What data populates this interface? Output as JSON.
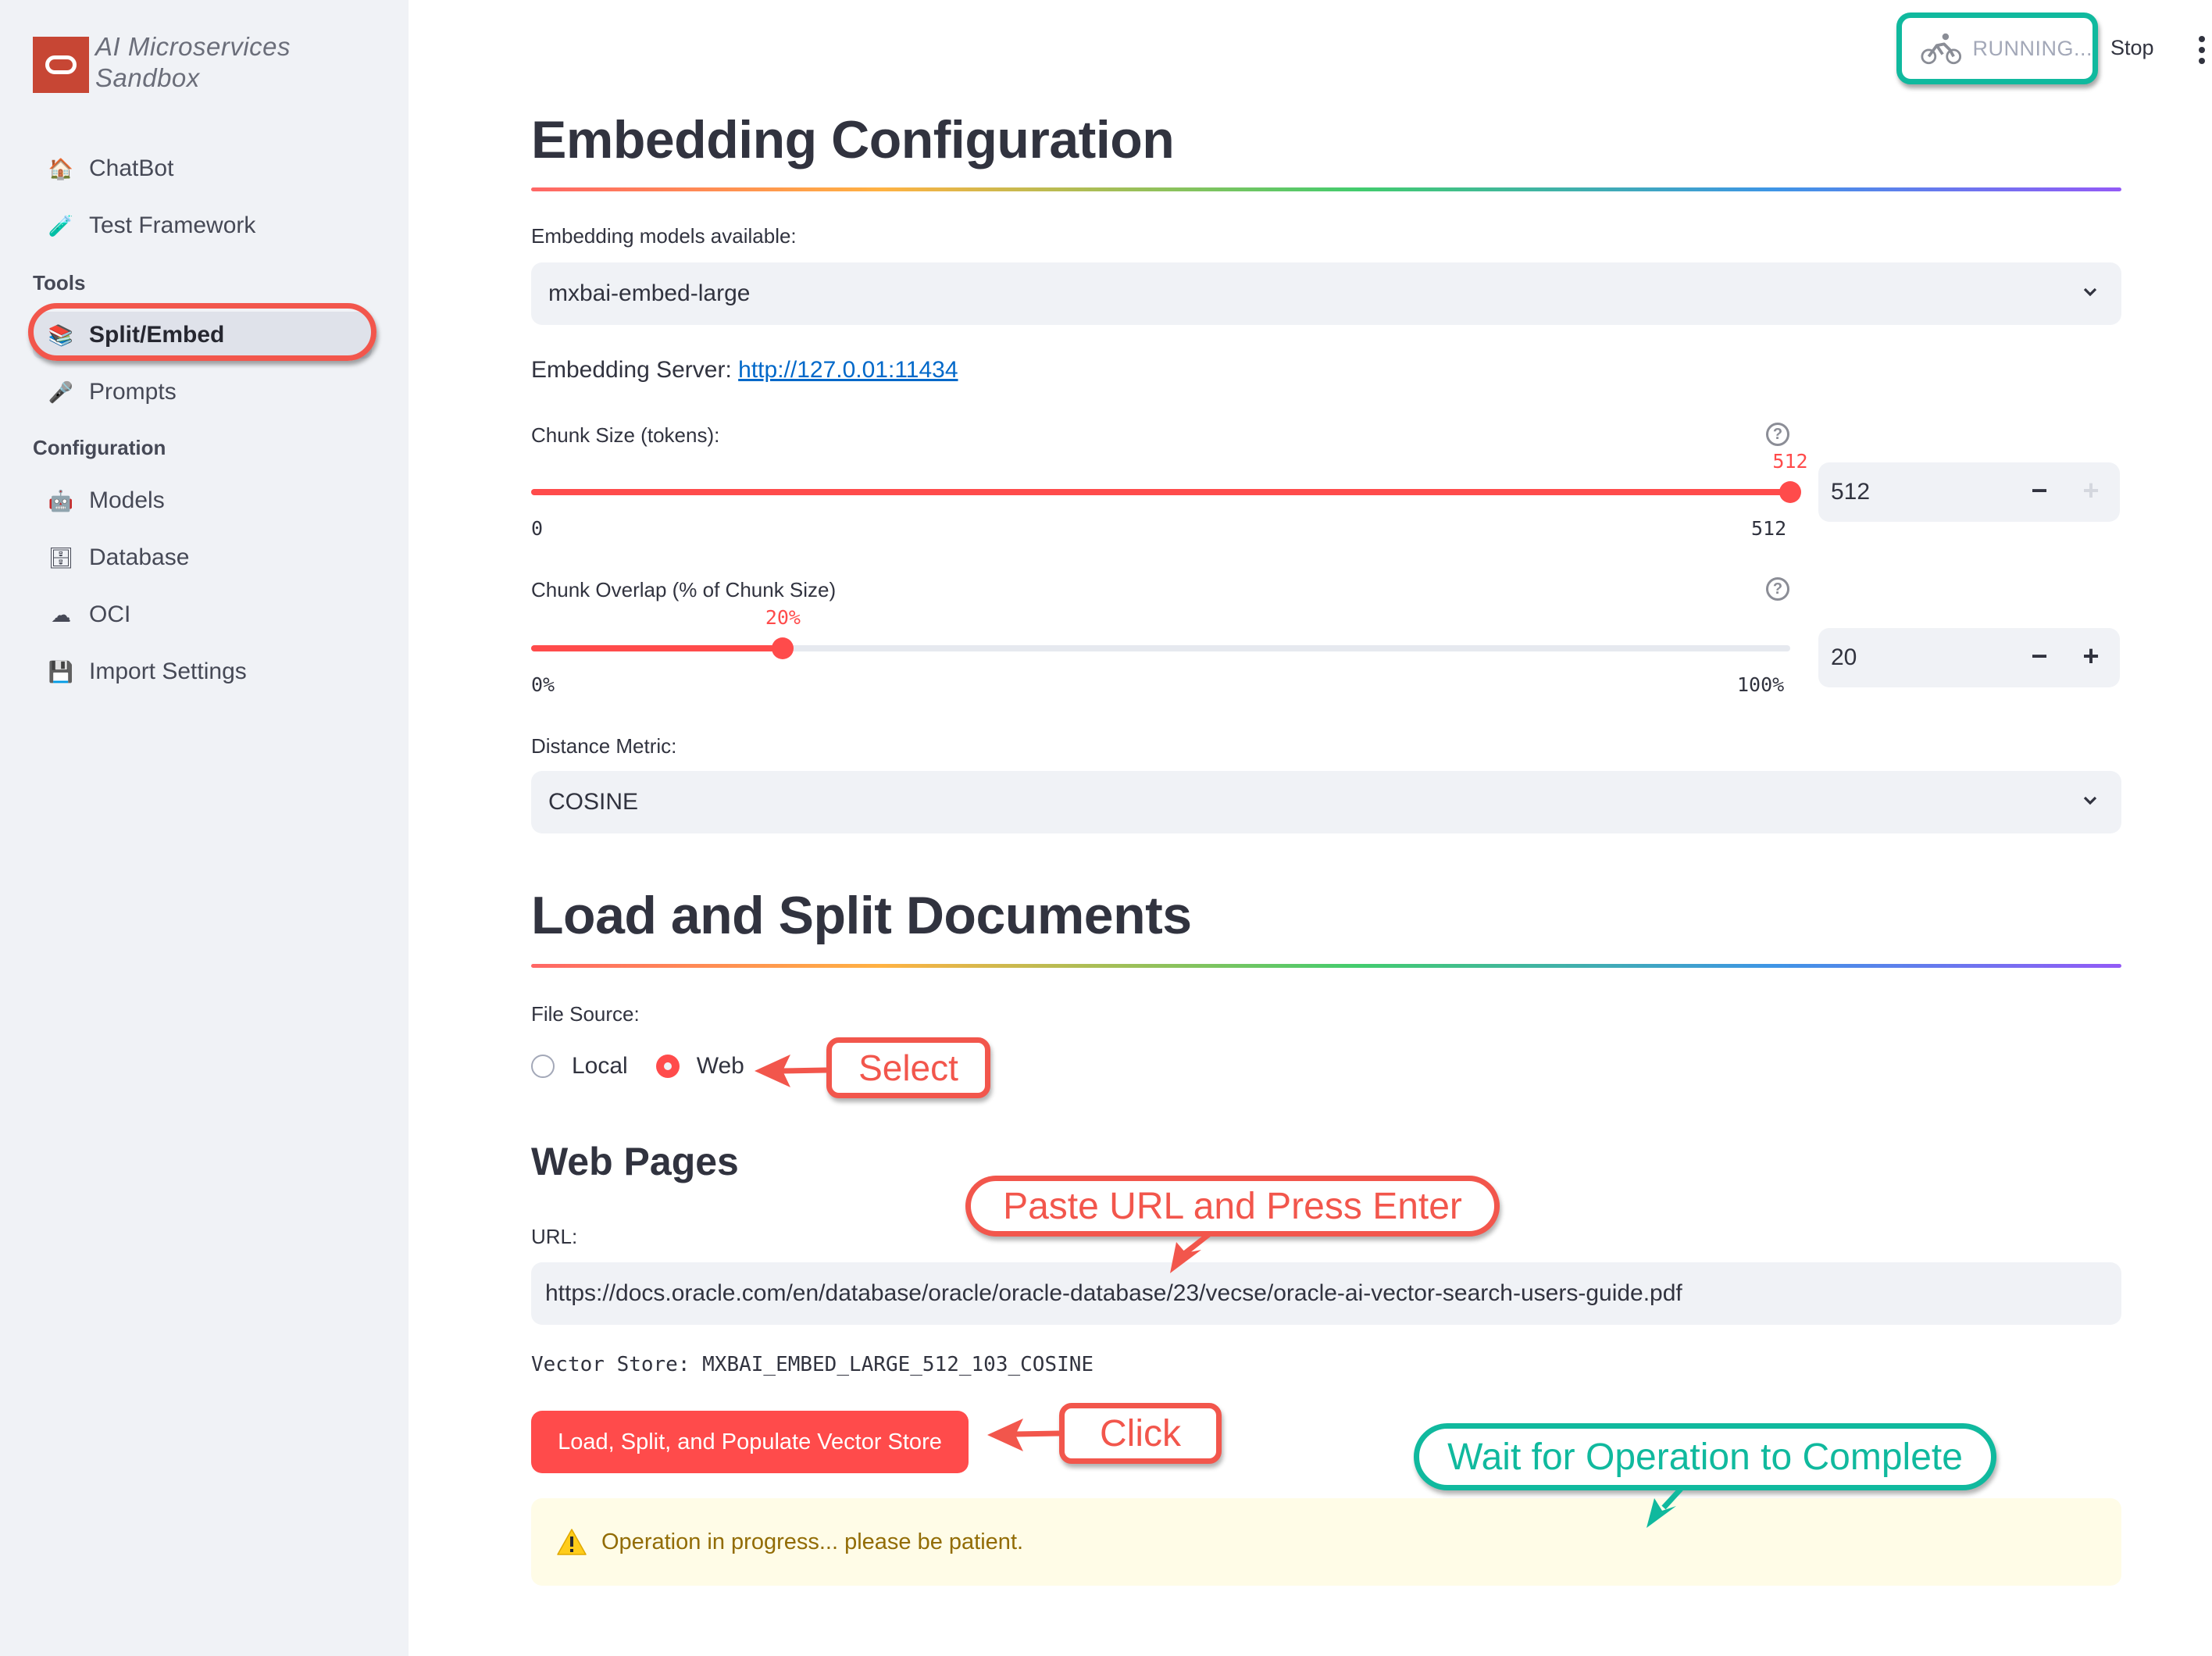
{
  "app": {
    "title": "AI Microservices Sandbox",
    "title_line1": "AI Microservices",
    "title_line2": "Sandbox"
  },
  "sidebar": {
    "items": [
      {
        "label": "ChatBot",
        "icon": "house-icon",
        "glyph": "🏠"
      },
      {
        "label": "Test Framework",
        "icon": "test-tube-icon",
        "glyph": "🧪"
      }
    ],
    "sections": [
      {
        "label": "Tools",
        "items": [
          {
            "label": "Split/Embed",
            "icon": "books-icon",
            "glyph": "📚",
            "active": true
          },
          {
            "label": "Prompts",
            "icon": "microphone-icon",
            "glyph": "🎤"
          }
        ]
      },
      {
        "label": "Configuration",
        "items": [
          {
            "label": "Models",
            "icon": "robot-icon",
            "glyph": "🤖"
          },
          {
            "label": "Database",
            "icon": "file-cabinet-icon",
            "glyph": "🗄"
          },
          {
            "label": "OCI",
            "icon": "cloud-icon",
            "glyph": "☁"
          },
          {
            "label": "Import Settings",
            "icon": "floppy-disk-icon",
            "glyph": "💾"
          }
        ]
      }
    ]
  },
  "toolbar": {
    "status": "RUNNING...",
    "stop_label": "Stop",
    "menu_icon": "kebab-menu-icon"
  },
  "embedding": {
    "heading": "Embedding Configuration",
    "models_label": "Embedding models available:",
    "model_selected": "mxbai-embed-large",
    "server_label": "Embedding Server:",
    "server_url": "http://127.0.01:11434",
    "chunk_size": {
      "label": "Chunk Size (tokens):",
      "value": 512,
      "value_label": "512",
      "min": 0,
      "max": 512,
      "min_label": "0",
      "max_label": "512",
      "input_value": "512",
      "plus_disabled": true
    },
    "chunk_overlap": {
      "label": "Chunk Overlap (% of Chunk Size)",
      "value": 20,
      "value_label": "20%",
      "min": 0,
      "max": 100,
      "min_label": "0%",
      "max_label": "100%",
      "input_value": "20",
      "plus_disabled": false
    },
    "distance_label": "Distance Metric:",
    "distance_selected": "COSINE"
  },
  "load": {
    "heading": "Load and Split Documents",
    "file_source_label": "File Source:",
    "options": [
      {
        "label": "Local",
        "selected": false
      },
      {
        "label": "Web",
        "selected": true
      }
    ],
    "web_heading": "Web Pages",
    "url_label": "URL:",
    "url_value": "https://docs.oracle.com/en/database/oracle/oracle-database/23/vecse/oracle-ai-vector-search-users-guide.pdf",
    "vector_store_text": "Vector Store: MXBAI_EMBED_LARGE_512_103_COSINE",
    "button_label": "Load, Split, and Populate Vector Store",
    "warning_text": "Operation in progress... please be patient."
  },
  "annotations": {
    "select": "Select",
    "paste": "Paste URL and Press Enter",
    "click": "Click",
    "wait": "Wait for Operation to Complete",
    "red": "#f2564c",
    "teal": "#10b99e"
  },
  "colors": {
    "accent": "#ff4b4b",
    "sidebar_bg": "#f0f2f6",
    "link": "#0068c9",
    "warning_bg": "#fffce7",
    "warning_text": "#926c05"
  }
}
